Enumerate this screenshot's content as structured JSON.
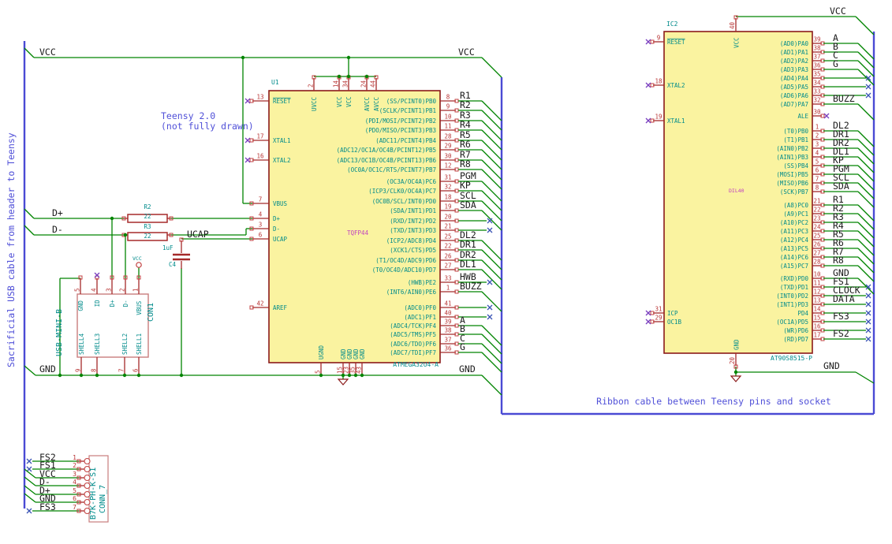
{
  "colors": {
    "wire": "#008400",
    "bus": "#4a4ad4",
    "component": "#8b1a1a",
    "chip_fill": "#faf3a0",
    "pin_stub": "#a52a2a",
    "pin_end": "#c24242",
    "pin_text": "#b83434",
    "name_text": "#008b8b",
    "label_text": "#1a1a1a",
    "note_text": "#5050d8",
    "package_text": "#c040c0",
    "nc_pin": "#7a3fbf",
    "nc_wire": "#3b55b5",
    "conn_box": "#c97d7d"
  },
  "net": {
    "vcc": "VCC",
    "gnd": "GND",
    "dplus": "D+",
    "dminus": "D-",
    "ucap": "UCAP"
  },
  "notes": {
    "sacrificial": "Sacrificial USB cable from header to Teensy",
    "teensy_line1": "Teensy 2.0",
    "teensy_line2": "(not fully drawn)",
    "ribbon": "Ribbon cable between Teensy pins and socket"
  },
  "u1": {
    "ref": "U1",
    "value": "ATMEGA32U4-A",
    "package": "TQFP44",
    "left_pins": [
      {
        "num": "13",
        "name": "RESET",
        "conn": "nc",
        "bar": true
      },
      {
        "num": "17",
        "name": "XTAL1",
        "conn": "nc"
      },
      {
        "num": "16",
        "name": "XTAL2",
        "conn": "nc"
      },
      {
        "num": "7",
        "name": "VBUS",
        "conn": "wire"
      },
      {
        "num": "4",
        "name": "D+",
        "conn": "wire"
      },
      {
        "num": "3",
        "name": "D-",
        "conn": "wire"
      },
      {
        "num": "6",
        "name": "UCAP",
        "conn": "wire"
      },
      {
        "num": "42",
        "name": "AREF",
        "conn": "open"
      }
    ],
    "top_pins": [
      {
        "num": "2",
        "name": "UVCC"
      },
      {
        "num": "14",
        "name": "VCC"
      },
      {
        "num": "34",
        "name": "VCC"
      },
      {
        "num": "24",
        "name": "AVCC"
      },
      {
        "num": "44",
        "name": "AVCC"
      }
    ],
    "bottom_pins": [
      {
        "num": "5",
        "name": "UGND"
      },
      {
        "num": "15",
        "name": "GND"
      },
      {
        "num": "23",
        "name": "GND"
      },
      {
        "num": "35",
        "name": "GND"
      },
      {
        "num": "43",
        "name": "GND"
      }
    ],
    "right_pins": [
      {
        "num": "8",
        "name": "(SS/PCINT0)PB0",
        "label": "R1",
        "conn": "bus"
      },
      {
        "num": "9",
        "name": "(SCLK/PCINT1)PB1",
        "label": "R2",
        "conn": "bus"
      },
      {
        "num": "10",
        "name": "(PDI/MOSI/PCINT2)PB2",
        "label": "R3",
        "conn": "bus"
      },
      {
        "num": "11",
        "name": "(PDO/MISO/PCINT3)PB3",
        "label": "R4",
        "conn": "bus"
      },
      {
        "num": "28",
        "name": "(ADC11/PCINT4)PB4",
        "label": "R5",
        "conn": "bus"
      },
      {
        "num": "29",
        "name": "(ADC12/OC1A/OC4B/PCINT12)PB5",
        "label": "R6",
        "conn": "bus"
      },
      {
        "num": "30",
        "name": "(ADC13/OC1B/OC4B/PCINT13)PB6",
        "label": "R7",
        "conn": "bus"
      },
      {
        "num": "12",
        "name": "(OC0A/OC1C/RTS/PCINT7)PB7",
        "label": "R8",
        "conn": "bus"
      },
      {
        "num": "31",
        "name": "(OC3A/OC4A)PC6",
        "label": "PGM",
        "conn": "bus"
      },
      {
        "num": "32",
        "name": "(ICP3/CLK0/OC4A)PC7",
        "label": "KP",
        "conn": "bus"
      },
      {
        "num": "18",
        "name": "(OC0B/SCL/INT0)PD0",
        "label": "SCL",
        "conn": "bus"
      },
      {
        "num": "19",
        "name": "(SDA/INT1)PD1",
        "label": "SDA",
        "conn": "bus"
      },
      {
        "num": "20",
        "name": "(RXD/INT2)PD2",
        "label": "",
        "conn": "ncwire"
      },
      {
        "num": "21",
        "name": "(TXD/INT3)PD3",
        "label": "",
        "conn": "ncwire"
      },
      {
        "num": "25",
        "name": "(ICP2/ADC8)PD4",
        "label": "DL2",
        "conn": "bus"
      },
      {
        "num": "22",
        "name": "(XCK1/CTS)PD5",
        "label": "DR1",
        "conn": "bus"
      },
      {
        "num": "26",
        "name": "(T1/OC4D/ADC9)PD6",
        "label": "DR2",
        "conn": "bus"
      },
      {
        "num": "27",
        "name": "(T0/OC4D/ADC10)PD7",
        "label": "DL1",
        "conn": "bus"
      },
      {
        "num": "33",
        "name": "(HWB)PE2",
        "label": "HWB",
        "conn": "ncwire"
      },
      {
        "num": "1",
        "name": "(INT6/AIN0)PE6",
        "label": "BUZZ",
        "conn": "bus"
      },
      {
        "num": "41",
        "name": "(ADC0)PF0",
        "label": "",
        "conn": "ncwire"
      },
      {
        "num": "40",
        "name": "(ADC1)PF1",
        "label": "",
        "conn": "ncwire"
      },
      {
        "num": "39",
        "name": "(ADC4/TCK)PF4",
        "label": "A",
        "conn": "bus"
      },
      {
        "num": "38",
        "name": "(ADC5/TMS)PF5",
        "label": "B",
        "conn": "bus"
      },
      {
        "num": "37",
        "name": "(ADC6/TDO)PF6",
        "label": "C",
        "conn": "bus"
      },
      {
        "num": "36",
        "name": "(ADC7/TDI)PF7",
        "label": "G",
        "conn": "bus"
      }
    ]
  },
  "ic2": {
    "ref": "IC2",
    "value": "AT90S8515-P",
    "package": "DIL40",
    "left_pins": [
      {
        "num": "9",
        "name": "RESET",
        "conn": "nc",
        "bar": true
      },
      {
        "num": "18",
        "name": "XTAL2",
        "conn": "nc"
      },
      {
        "num": "19",
        "name": "XTAL1",
        "conn": "nc"
      },
      {
        "num": "31",
        "name": "ICP",
        "conn": "nc"
      },
      {
        "num": "29",
        "name": "OC1B",
        "conn": "nc"
      }
    ],
    "top_pins": [
      {
        "num": "40",
        "name": "VCC"
      }
    ],
    "bottom_pins": [
      {
        "num": "20",
        "name": "GND"
      }
    ],
    "right_pins": [
      {
        "num": "39",
        "name": "(AD0)PA0",
        "label": "A",
        "conn": "bus"
      },
      {
        "num": "38",
        "name": "(AD1)PA1",
        "label": "B",
        "conn": "bus"
      },
      {
        "num": "37",
        "name": "(AD2)PA2",
        "label": "C",
        "conn": "bus"
      },
      {
        "num": "36",
        "name": "(AD3)PA3",
        "label": "G",
        "conn": "bus"
      },
      {
        "num": "35",
        "name": "(AD4)PA4",
        "label": "",
        "conn": "ncwire"
      },
      {
        "num": "34",
        "name": "(AD5)PA5",
        "label": "",
        "conn": "ncwire"
      },
      {
        "num": "33",
        "name": "(AD6)PA6",
        "label": "",
        "conn": "ncwire"
      },
      {
        "num": "32",
        "name": "(AD7)PA7",
        "label": "BUZZ",
        "conn": "bus"
      },
      {
        "num": "30",
        "name": "ALE",
        "label": "",
        "conn": "nc"
      },
      {
        "num": "1",
        "name": "(T0)PB0",
        "label": "DL2",
        "conn": "bus"
      },
      {
        "num": "2",
        "name": "(T1)PB1",
        "label": "DR1",
        "conn": "bus"
      },
      {
        "num": "3",
        "name": "(AIN0)PB2",
        "label": "DR2",
        "conn": "bus"
      },
      {
        "num": "4",
        "name": "(AIN1)PB3",
        "label": "DL1",
        "conn": "bus"
      },
      {
        "num": "5",
        "name": "(SS)PB4",
        "label": "KP",
        "conn": "bus"
      },
      {
        "num": "6",
        "name": "(MOSI)PB5",
        "label": "PGM",
        "conn": "bus"
      },
      {
        "num": "7",
        "name": "(MISO)PB6",
        "label": "SCL",
        "conn": "bus"
      },
      {
        "num": "8",
        "name": "(SCK)PB7",
        "label": "SDA",
        "conn": "bus"
      },
      {
        "num": "21",
        "name": "(A8)PC0",
        "label": "R1",
        "conn": "bus"
      },
      {
        "num": "22",
        "name": "(A9)PC1",
        "label": "R2",
        "conn": "bus"
      },
      {
        "num": "23",
        "name": "(A10)PC2",
        "label": "R3",
        "conn": "bus"
      },
      {
        "num": "24",
        "name": "(A11)PC3",
        "label": "R4",
        "conn": "bus"
      },
      {
        "num": "25",
        "name": "(A12)PC4",
        "label": "R5",
        "conn": "bus"
      },
      {
        "num": "26",
        "name": "(A13)PC5",
        "label": "R6",
        "conn": "bus"
      },
      {
        "num": "27",
        "name": "(A14)PC6",
        "label": "R7",
        "conn": "bus"
      },
      {
        "num": "28",
        "name": "(A15)PC7",
        "label": "R8",
        "conn": "bus"
      },
      {
        "num": "10",
        "name": "(RXD)PD0",
        "label": "GND",
        "conn": "bus"
      },
      {
        "num": "11",
        "name": "(TXD)PD1",
        "label": "FS1",
        "conn": "ncwire"
      },
      {
        "num": "12",
        "name": "(INT0)PD2",
        "label": "CLOCK",
        "conn": "ncwire"
      },
      {
        "num": "13",
        "name": "(INT1)PD3",
        "label": "DATA",
        "conn": "ncwire"
      },
      {
        "num": "14",
        "name": "PD4",
        "label": "",
        "conn": "ncwire"
      },
      {
        "num": "15",
        "name": "(OC1A)PD5",
        "label": "FS3",
        "conn": "ncwire"
      },
      {
        "num": "16",
        "name": "(WR)PD6",
        "label": "",
        "conn": "ncwire"
      },
      {
        "num": "17",
        "name": "(RD)PD7",
        "label": "FS2",
        "conn": "ncwire"
      }
    ]
  },
  "con1": {
    "ref": "CON1",
    "value": "USB-MINI-B",
    "top_pins": [
      {
        "num": "5",
        "name": "GND"
      },
      {
        "num": "4",
        "name": "ID",
        "nc": true
      },
      {
        "num": "3",
        "name": "D+"
      },
      {
        "num": "2",
        "name": "D-"
      },
      {
        "num": "1",
        "name": "VBUS"
      }
    ],
    "bottom_pins": [
      {
        "num": "9",
        "name": "SHELL4"
      },
      {
        "num": "8",
        "name": "SHELL3"
      },
      {
        "num": "7",
        "name": "SHELL2"
      },
      {
        "num": "6",
        "name": "SHELL1"
      }
    ]
  },
  "conn7": {
    "ref": "CONN_7",
    "value": "B7K-PH-K-S1",
    "pins": [
      {
        "num": "1",
        "label": "FS2",
        "nc": true
      },
      {
        "num": "2",
        "label": "FS1",
        "nc": true
      },
      {
        "num": "3",
        "label": "VCC"
      },
      {
        "num": "4",
        "label": "D-"
      },
      {
        "num": "5",
        "label": "D+"
      },
      {
        "num": "6",
        "label": "GND"
      },
      {
        "num": "7",
        "label": "FS3",
        "nc": true
      }
    ]
  },
  "r2": {
    "ref": "R2",
    "value": "22"
  },
  "r3": {
    "ref": "R3",
    "value": "22"
  },
  "c4": {
    "ref": "C4",
    "value": "1uF"
  }
}
